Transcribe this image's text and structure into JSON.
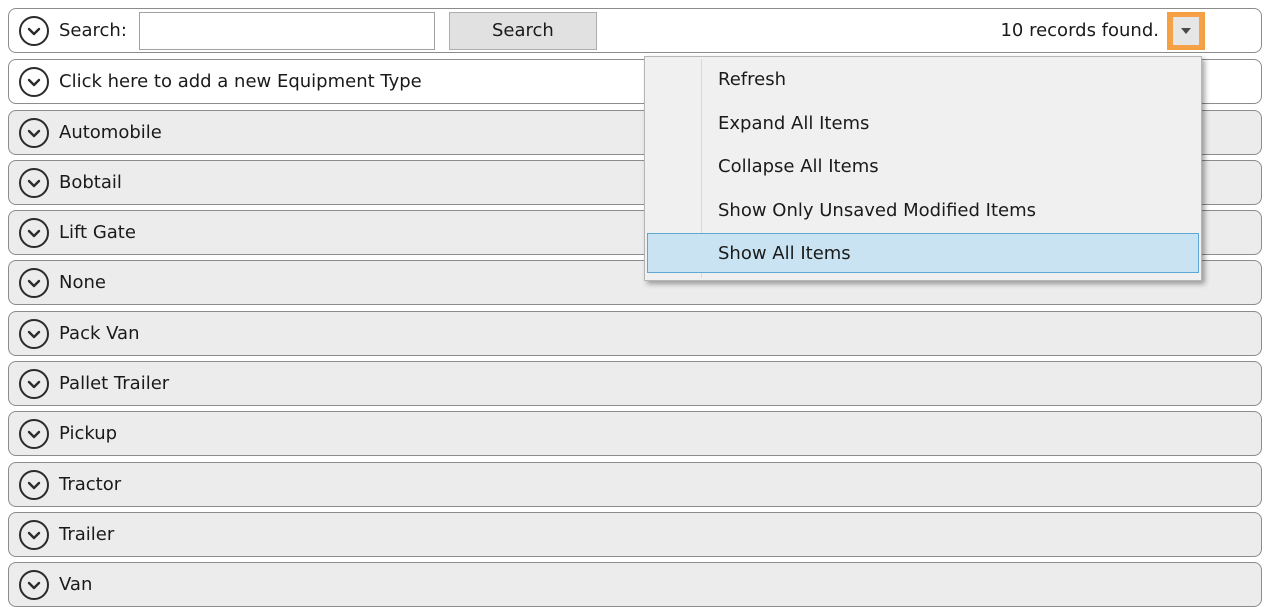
{
  "header": {
    "search_label": "Search:",
    "search_value": "",
    "search_button": "Search",
    "records_text": "10 records found."
  },
  "add_row": {
    "label": "Click here to add a new Equipment Type"
  },
  "items": [
    {
      "label": "Automobile"
    },
    {
      "label": "Bobtail"
    },
    {
      "label": "Lift Gate"
    },
    {
      "label": "None"
    },
    {
      "label": "Pack Van"
    },
    {
      "label": "Pallet Trailer"
    },
    {
      "label": "Pickup"
    },
    {
      "label": "Tractor"
    },
    {
      "label": "Trailer"
    },
    {
      "label": "Van"
    }
  ],
  "menu": {
    "items": [
      {
        "label": "Refresh"
      },
      {
        "label": "Expand All Items"
      },
      {
        "label": "Collapse All Items"
      },
      {
        "label": "Show Only Unsaved Modified Items"
      },
      {
        "label": "Show All Items",
        "highlighted": true
      }
    ]
  },
  "icons": {
    "row_toggle": "chevron-down-circle-icon",
    "menu_toggle": "triangle-down-icon"
  },
  "colors": {
    "accent_orange": "#f6a047",
    "menu_highlight": "#c9e3f2",
    "menu_highlight_border": "#5fa8d3",
    "row_background": "#ececec"
  }
}
